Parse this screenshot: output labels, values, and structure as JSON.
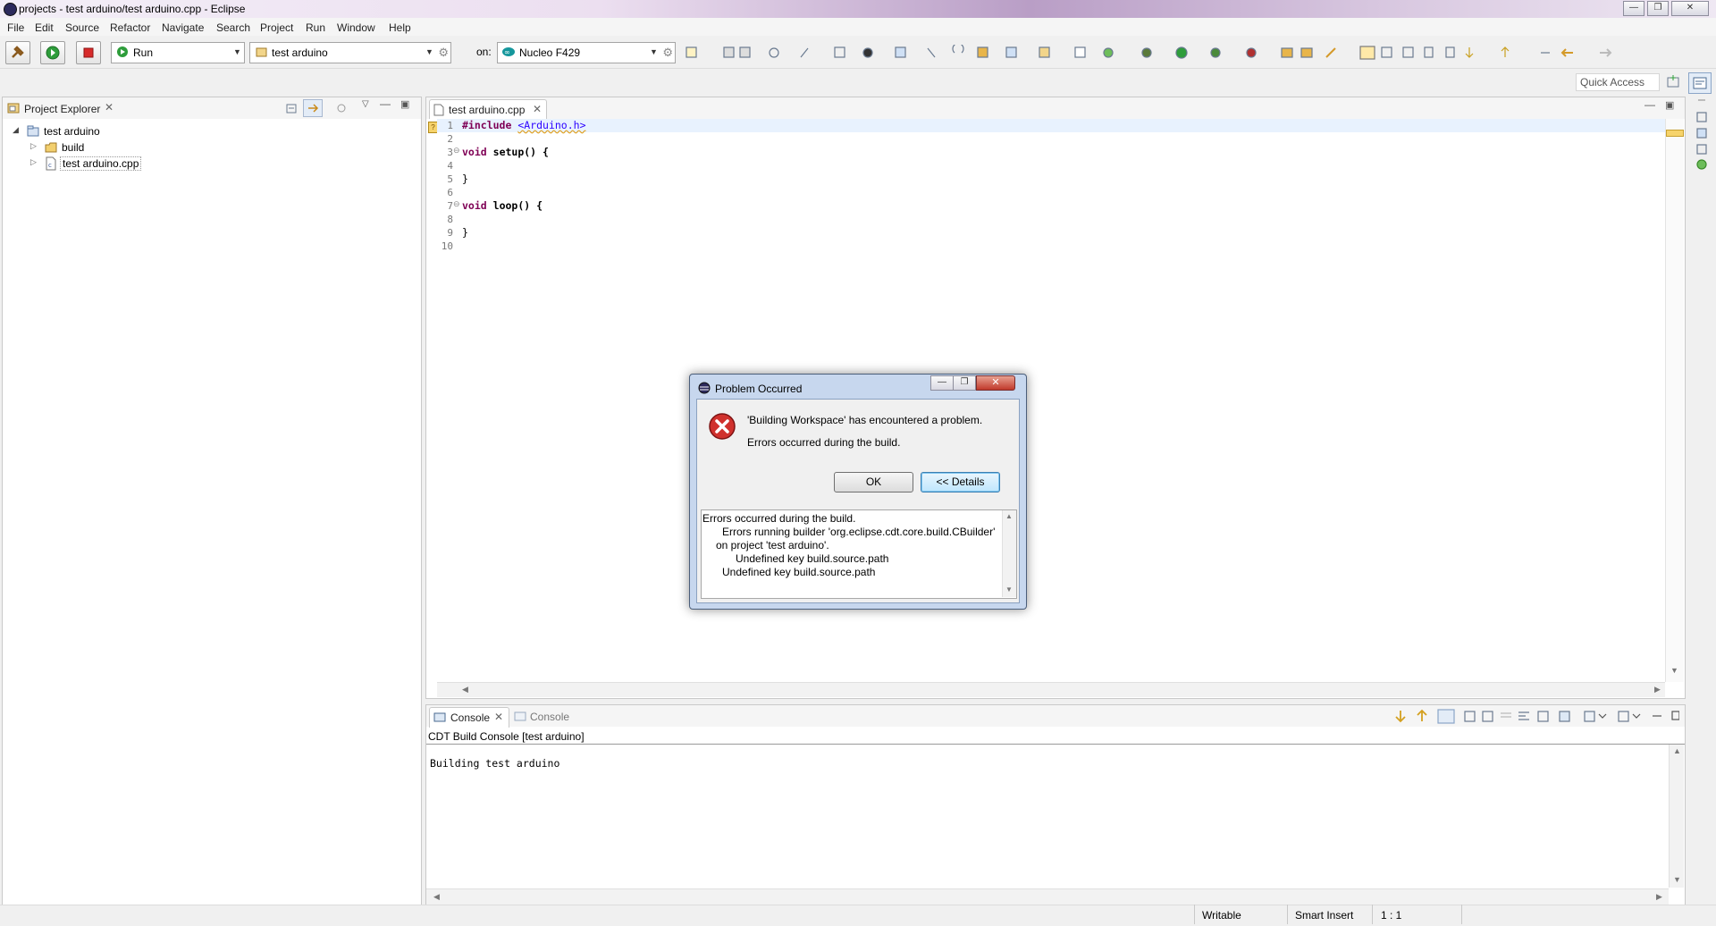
{
  "window": {
    "title": "projects - test arduino/test arduino.cpp - Eclipse",
    "controls": {
      "minimize": "—",
      "restore": "❐",
      "close": "✕"
    }
  },
  "menu": [
    "File",
    "Edit",
    "Source",
    "Refactor",
    "Navigate",
    "Search",
    "Project",
    "Run",
    "Window",
    "Help"
  ],
  "toolbar": {
    "launch_mode": "Run",
    "launch_config": "test arduino",
    "on_label": "on:",
    "target": "Nucleo F429",
    "quick_access": "Quick Access"
  },
  "project_explorer": {
    "title": "Project Explorer",
    "tree": {
      "project": "test arduino",
      "children": [
        "build",
        "test arduino.cpp"
      ]
    }
  },
  "editor": {
    "tab": "test arduino.cpp",
    "line_numbers": [
      "1",
      "2",
      "3",
      "4",
      "5",
      "6",
      "7",
      "8",
      "9",
      "10"
    ],
    "lines": {
      "l1_kw": "#include",
      "l1_rest": "<Arduino.h>",
      "l3_kw": "void",
      "l3_rest": "setup() {",
      "l5": "}",
      "l7_kw": "void",
      "l7_rest": "loop() {",
      "l9": "}"
    }
  },
  "console": {
    "tab_active": "Console",
    "tab_inactive": "Console",
    "header": "CDT Build Console [test arduino]",
    "output": "Building test arduino"
  },
  "dialog": {
    "title": "Problem Occurred",
    "message": "'Building Workspace' has encountered a problem.",
    "submessage": "Errors occurred during the build.",
    "ok_label": "OK",
    "details_label": "<< Details",
    "details_lines": [
      "Errors occurred during the build.",
      "Errors running builder 'org.eclipse.cdt.core.build.CBuilder'",
      "on project 'test arduino'.",
      "Undefined key build.source.path",
      "Undefined key build.source.path"
    ]
  },
  "status": {
    "writable": "Writable",
    "insert_mode": "Smart Insert",
    "position": "1 : 1"
  },
  "colors": {
    "keyword": "#7f0055",
    "error_red": "#d0312d",
    "selection_blue": "#3399ff"
  }
}
